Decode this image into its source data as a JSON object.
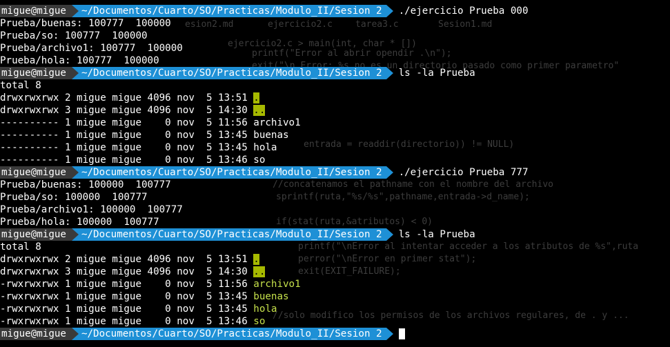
{
  "prompt": {
    "user_host": "migue@migue",
    "path": "~/Documentos/Cuarto/SO/Practicas/Modulo_II/Sesion 2"
  },
  "blocks": [
    {
      "command": "./ejercicio Prueba 000",
      "output": [
        "Prueba/buenas: 100777  100000",
        "Prueba/so: 100777  100000",
        "Prueba/archivo1: 100777  100000",
        "Prueba/hola: 100777  100000"
      ]
    },
    {
      "command": "ls -la Prueba",
      "listing": {
        "total": "total 8",
        "rows": [
          {
            "prefix": "drwxrwxrwx 2 migue migue 4096 nov  5 13:51 ",
            "name": ".",
            "kind": "dir"
          },
          {
            "prefix": "drwxrwxrwx 3 migue migue 4096 nov  5 14:30 ",
            "name": "..",
            "kind": "dir"
          },
          {
            "prefix": "---------- 1 migue migue    0 nov  5 11:56 ",
            "name": "archivo1",
            "kind": "plain"
          },
          {
            "prefix": "---------- 1 migue migue    0 nov  5 13:45 ",
            "name": "buenas",
            "kind": "plain"
          },
          {
            "prefix": "---------- 1 migue migue    0 nov  5 13:45 ",
            "name": "hola",
            "kind": "plain"
          },
          {
            "prefix": "---------- 1 migue migue    0 nov  5 13:46 ",
            "name": "so",
            "kind": "plain"
          }
        ]
      }
    },
    {
      "command": "./ejercicio Prueba 777",
      "output": [
        "Prueba/buenas: 100000  100777",
        "Prueba/so: 100000  100777",
        "Prueba/archivo1: 100000  100777",
        "Prueba/hola: 100000  100777"
      ]
    },
    {
      "command": "ls -la Prueba",
      "listing": {
        "total": "total 8",
        "rows": [
          {
            "prefix": "drwxrwxrwx 2 migue migue 4096 nov  5 13:51 ",
            "name": ".",
            "kind": "dir"
          },
          {
            "prefix": "drwxrwxrwx 3 migue migue 4096 nov  5 14:30 ",
            "name": "..",
            "kind": "dir"
          },
          {
            "prefix": "-rwxrwxrwx 1 migue migue    0 nov  5 11:56 ",
            "name": "archivo1",
            "kind": "exec"
          },
          {
            "prefix": "-rwxrwxrwx 1 migue migue    0 nov  5 13:45 ",
            "name": "buenas",
            "kind": "exec"
          },
          {
            "prefix": "-rwxrwxrwx 1 migue migue    0 nov  5 13:45 ",
            "name": "hola",
            "kind": "exec"
          },
          {
            "prefix": "-rwxrwxrwx 1 migue migue    0 nov  5 13:46 ",
            "name": "so",
            "kind": "exec"
          }
        ]
      }
    }
  ],
  "colors": {
    "background": "#000000",
    "user_segment": "#3a3a3a",
    "path_segment": "#1e90d6",
    "dir_highlight": "#a6b900",
    "exec_file": "#c6e14b"
  },
  "background_ghost": {
    "tabs": [
      "esion2.md",
      "ejercicio2.c",
      "tarea3.c",
      "Sesion1.md"
    ],
    "breadcrumb": "ejercicio2.c > main(int, char * [])",
    "code": [
      "printf(\"Error al abrir opendir .\\n\");",
      "exit(\"\\n Error: %s no es un directorio pasado como primer parametro\"",
      "entrada = readdir(directorio)) != NULL)",
      "//concatenamos el pathname con el nombre del archivo",
      "sprintf(ruta,\"%s/%s\",pathname,entrada->d_name);",
      "if(stat(ruta,&atributos) < 0)",
      "printf(\"\\nError al intentar acceder a los atributos de %s\",ruta",
      "perror(\"\\nError en primer stat\");",
      "exit(EXIT_FAILURE);",
      "//solo modifico los permisos de los archivos regulares, de . y ..."
    ]
  }
}
